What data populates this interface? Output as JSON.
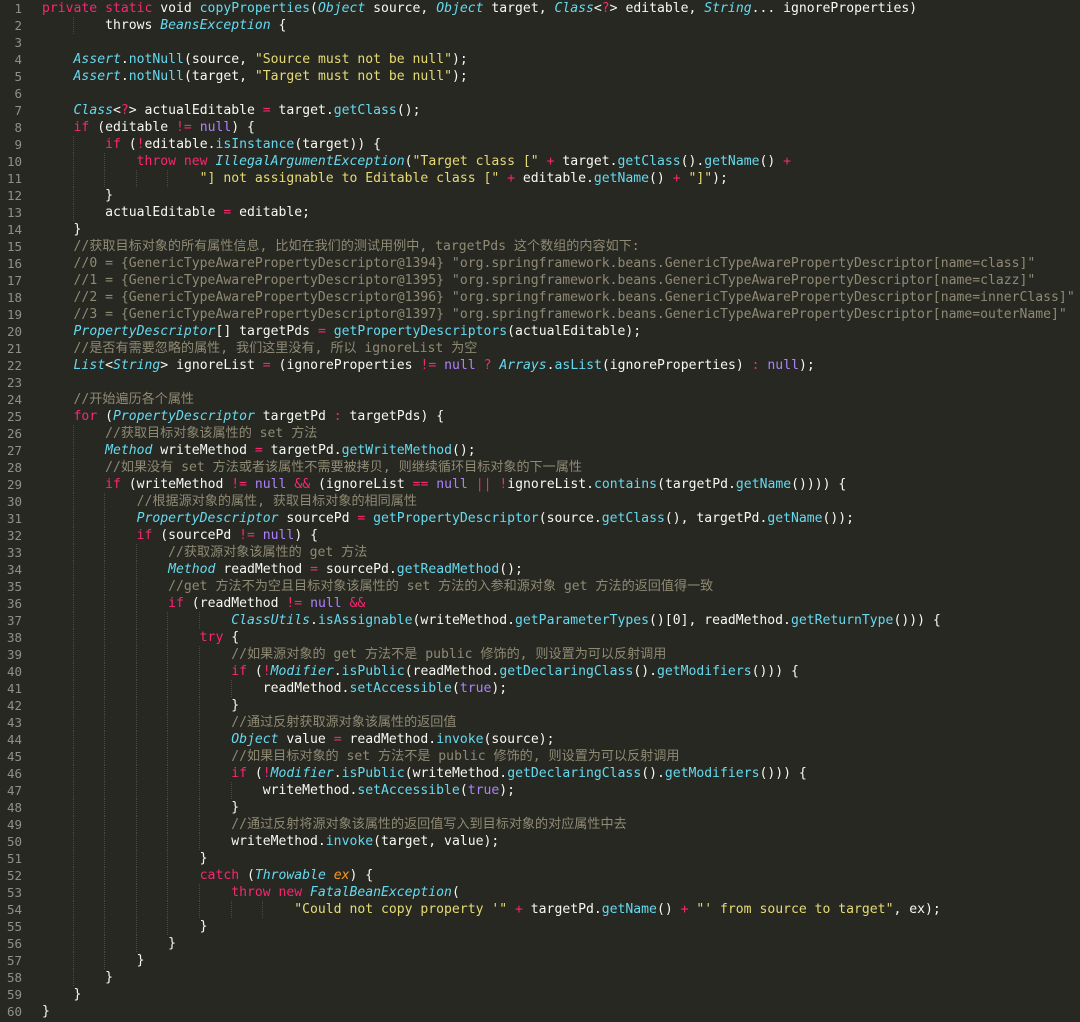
{
  "editor": {
    "theme_colors": {
      "background": "#272822",
      "text": "#f8f8f2",
      "keyword": "#f92672",
      "string": "#e6db74",
      "function": "#66d9ef",
      "comment": "#8f8a74",
      "parameter": "#fd971f",
      "constant": "#ae81ff",
      "line_number": "#90908a"
    },
    "lines": [
      [
        [
          "k",
          "private static "
        ],
        [
          "g",
          "void "
        ],
        [
          "f",
          "copyProperties"
        ],
        [
          "g",
          "("
        ],
        [
          "t",
          "Object"
        ],
        [
          "g",
          " source, "
        ],
        [
          "t",
          "Object"
        ],
        [
          "g",
          " target, "
        ],
        [
          "t",
          "Class"
        ],
        [
          "g",
          "<"
        ],
        [
          "k",
          "?"
        ],
        [
          "g",
          "> editable, "
        ],
        [
          "t",
          "String"
        ],
        [
          "g",
          "... ignoreProperties)"
        ]
      ],
      [
        [
          "g",
          "        throws "
        ],
        [
          "t",
          "BeansException"
        ],
        [
          "g",
          " {"
        ]
      ],
      [
        [
          "g",
          ""
        ]
      ],
      [
        [
          "g",
          "    "
        ],
        [
          "t",
          "Assert"
        ],
        [
          "g",
          "."
        ],
        [
          "f",
          "notNull"
        ],
        [
          "g",
          "(source, "
        ],
        [
          "s",
          "\"Source must not be null\""
        ],
        [
          "g",
          ");"
        ]
      ],
      [
        [
          "g",
          "    "
        ],
        [
          "t",
          "Assert"
        ],
        [
          "g",
          "."
        ],
        [
          "f",
          "notNull"
        ],
        [
          "g",
          "(target, "
        ],
        [
          "s",
          "\"Target must not be null\""
        ],
        [
          "g",
          ");"
        ]
      ],
      [
        [
          "g",
          ""
        ]
      ],
      [
        [
          "g",
          "    "
        ],
        [
          "t",
          "Class"
        ],
        [
          "g",
          "<"
        ],
        [
          "k",
          "?"
        ],
        [
          "g",
          "> actualEditable "
        ],
        [
          "k",
          "="
        ],
        [
          "g",
          " target."
        ],
        [
          "f",
          "getClass"
        ],
        [
          "g",
          "();"
        ]
      ],
      [
        [
          "g",
          "    "
        ],
        [
          "k",
          "if"
        ],
        [
          "g",
          " (editable "
        ],
        [
          "k",
          "!="
        ],
        [
          "g",
          " "
        ],
        [
          "n",
          "null"
        ],
        [
          "g",
          ") {"
        ]
      ],
      [
        [
          "g",
          "        "
        ],
        [
          "k",
          "if"
        ],
        [
          "g",
          " ("
        ],
        [
          "k",
          "!"
        ],
        [
          "g",
          "editable."
        ],
        [
          "f",
          "isInstance"
        ],
        [
          "g",
          "(target)) {"
        ]
      ],
      [
        [
          "g",
          "            "
        ],
        [
          "k",
          "throw new "
        ],
        [
          "t",
          "IllegalArgumentException"
        ],
        [
          "g",
          "("
        ],
        [
          "s",
          "\"Target class [\""
        ],
        [
          "g",
          " "
        ],
        [
          "k",
          "+"
        ],
        [
          "g",
          " target."
        ],
        [
          "f",
          "getClass"
        ],
        [
          "g",
          "()."
        ],
        [
          "f",
          "getName"
        ],
        [
          "g",
          "() "
        ],
        [
          "k",
          "+"
        ]
      ],
      [
        [
          "g",
          "                    "
        ],
        [
          "s",
          "\"] not assignable to Editable class [\""
        ],
        [
          "g",
          " "
        ],
        [
          "k",
          "+"
        ],
        [
          "g",
          " editable."
        ],
        [
          "f",
          "getName"
        ],
        [
          "g",
          "() "
        ],
        [
          "k",
          "+"
        ],
        [
          "g",
          " "
        ],
        [
          "s",
          "\"]\""
        ],
        [
          "g",
          ");"
        ]
      ],
      [
        [
          "g",
          "        }"
        ]
      ],
      [
        [
          "g",
          "        actualEditable "
        ],
        [
          "k",
          "="
        ],
        [
          "g",
          " editable;"
        ]
      ],
      [
        [
          "g",
          "    }"
        ]
      ],
      [
        [
          "g",
          "    "
        ],
        [
          "c",
          "//获取目标对象的所有属性信息, 比如在我们的测试用例中, targetPds 这个数组的内容如下:"
        ]
      ],
      [
        [
          "g",
          "    "
        ],
        [
          "c",
          "//0 = {GenericTypeAwarePropertyDescriptor@1394} \"org.springframework.beans.GenericTypeAwarePropertyDescriptor[name=class]\""
        ]
      ],
      [
        [
          "g",
          "    "
        ],
        [
          "c",
          "//1 = {GenericTypeAwarePropertyDescriptor@1395} \"org.springframework.beans.GenericTypeAwarePropertyDescriptor[name=clazz]\""
        ]
      ],
      [
        [
          "g",
          "    "
        ],
        [
          "c",
          "//2 = {GenericTypeAwarePropertyDescriptor@1396} \"org.springframework.beans.GenericTypeAwarePropertyDescriptor[name=innerClass]\""
        ]
      ],
      [
        [
          "g",
          "    "
        ],
        [
          "c",
          "//3 = {GenericTypeAwarePropertyDescriptor@1397} \"org.springframework.beans.GenericTypeAwarePropertyDescriptor[name=outerName]\""
        ]
      ],
      [
        [
          "g",
          "    "
        ],
        [
          "t",
          "PropertyDescriptor"
        ],
        [
          "g",
          "[] targetPds "
        ],
        [
          "k",
          "="
        ],
        [
          "g",
          " "
        ],
        [
          "f",
          "getPropertyDescriptors"
        ],
        [
          "g",
          "(actualEditable);"
        ]
      ],
      [
        [
          "g",
          "    "
        ],
        [
          "c",
          "//是否有需要忽略的属性, 我们这里没有, 所以 ignoreList 为空"
        ]
      ],
      [
        [
          "g",
          "    "
        ],
        [
          "t",
          "List"
        ],
        [
          "g",
          "<"
        ],
        [
          "t",
          "String"
        ],
        [
          "g",
          "> ignoreList "
        ],
        [
          "k",
          "="
        ],
        [
          "g",
          " (ignoreProperties "
        ],
        [
          "k",
          "!="
        ],
        [
          "g",
          " "
        ],
        [
          "n",
          "null"
        ],
        [
          "g",
          " "
        ],
        [
          "k",
          "?"
        ],
        [
          "g",
          " "
        ],
        [
          "t",
          "Arrays"
        ],
        [
          "g",
          "."
        ],
        [
          "f",
          "asList"
        ],
        [
          "g",
          "(ignoreProperties) "
        ],
        [
          "k",
          ":"
        ],
        [
          "g",
          " "
        ],
        [
          "n",
          "null"
        ],
        [
          "g",
          ");"
        ]
      ],
      [
        [
          "g",
          ""
        ]
      ],
      [
        [
          "g",
          "    "
        ],
        [
          "c",
          "//开始遍历各个属性"
        ]
      ],
      [
        [
          "g",
          "    "
        ],
        [
          "k",
          "for"
        ],
        [
          "g",
          " ("
        ],
        [
          "t",
          "PropertyDescriptor"
        ],
        [
          "g",
          " targetPd "
        ],
        [
          "k",
          ":"
        ],
        [
          "g",
          " targetPds) {"
        ]
      ],
      [
        [
          "g",
          "        "
        ],
        [
          "c",
          "//获取目标对象该属性的 set 方法"
        ]
      ],
      [
        [
          "g",
          "        "
        ],
        [
          "t",
          "Method"
        ],
        [
          "g",
          " writeMethod "
        ],
        [
          "k",
          "="
        ],
        [
          "g",
          " targetPd."
        ],
        [
          "f",
          "getWriteMethod"
        ],
        [
          "g",
          "();"
        ]
      ],
      [
        [
          "g",
          "        "
        ],
        [
          "c",
          "//如果没有 set 方法或者该属性不需要被拷贝, 则继续循环目标对象的下一属性"
        ]
      ],
      [
        [
          "g",
          "        "
        ],
        [
          "k",
          "if"
        ],
        [
          "g",
          " (writeMethod "
        ],
        [
          "k",
          "!="
        ],
        [
          "g",
          " "
        ],
        [
          "n",
          "null"
        ],
        [
          "g",
          " "
        ],
        [
          "k",
          "&&"
        ],
        [
          "g",
          " (ignoreList "
        ],
        [
          "k",
          "=="
        ],
        [
          "g",
          " "
        ],
        [
          "n",
          "null"
        ],
        [
          "g",
          " "
        ],
        [
          "k",
          "||"
        ],
        [
          "g",
          " "
        ],
        [
          "k",
          "!"
        ],
        [
          "g",
          "ignoreList."
        ],
        [
          "f",
          "contains"
        ],
        [
          "g",
          "(targetPd."
        ],
        [
          "f",
          "getName"
        ],
        [
          "g",
          "()))) {"
        ]
      ],
      [
        [
          "g",
          "            "
        ],
        [
          "c",
          "//根据源对象的属性, 获取目标对象的相同属性"
        ]
      ],
      [
        [
          "g",
          "            "
        ],
        [
          "t",
          "PropertyDescriptor"
        ],
        [
          "g",
          " sourcePd "
        ],
        [
          "k",
          "="
        ],
        [
          "g",
          " "
        ],
        [
          "f",
          "getPropertyDescriptor"
        ],
        [
          "g",
          "(source."
        ],
        [
          "f",
          "getClass"
        ],
        [
          "g",
          "(), targetPd."
        ],
        [
          "f",
          "getName"
        ],
        [
          "g",
          "());"
        ]
      ],
      [
        [
          "g",
          "            "
        ],
        [
          "k",
          "if"
        ],
        [
          "g",
          " (sourcePd "
        ],
        [
          "k",
          "!="
        ],
        [
          "g",
          " "
        ],
        [
          "n",
          "null"
        ],
        [
          "g",
          ") {"
        ]
      ],
      [
        [
          "g",
          "                "
        ],
        [
          "c",
          "//获取源对象该属性的 get 方法"
        ]
      ],
      [
        [
          "g",
          "                "
        ],
        [
          "t",
          "Method"
        ],
        [
          "g",
          " readMethod "
        ],
        [
          "k",
          "="
        ],
        [
          "g",
          " sourcePd."
        ],
        [
          "f",
          "getReadMethod"
        ],
        [
          "g",
          "();"
        ]
      ],
      [
        [
          "g",
          "                "
        ],
        [
          "c",
          "//get 方法不为空且目标对象该属性的 set 方法的入参和源对象 get 方法的返回值得一致"
        ]
      ],
      [
        [
          "g",
          "                "
        ],
        [
          "k",
          "if"
        ],
        [
          "g",
          " (readMethod "
        ],
        [
          "k",
          "!="
        ],
        [
          "g",
          " "
        ],
        [
          "n",
          "null"
        ],
        [
          "g",
          " "
        ],
        [
          "k",
          "&&"
        ]
      ],
      [
        [
          "g",
          "                        "
        ],
        [
          "t",
          "ClassUtils"
        ],
        [
          "g",
          "."
        ],
        [
          "f",
          "isAssignable"
        ],
        [
          "g",
          "(writeMethod."
        ],
        [
          "f",
          "getParameterTypes"
        ],
        [
          "g",
          "()[0], readMethod."
        ],
        [
          "f",
          "getReturnType"
        ],
        [
          "g",
          "())) {"
        ]
      ],
      [
        [
          "g",
          "                    "
        ],
        [
          "k",
          "try"
        ],
        [
          "g",
          " {"
        ]
      ],
      [
        [
          "g",
          "                        "
        ],
        [
          "c",
          "//如果源对象的 get 方法不是 public 修饰的, 则设置为可以反射调用"
        ]
      ],
      [
        [
          "g",
          "                        "
        ],
        [
          "k",
          "if"
        ],
        [
          "g",
          " ("
        ],
        [
          "k",
          "!"
        ],
        [
          "t",
          "Modifier"
        ],
        [
          "g",
          "."
        ],
        [
          "f",
          "isPublic"
        ],
        [
          "g",
          "(readMethod."
        ],
        [
          "f",
          "getDeclaringClass"
        ],
        [
          "g",
          "()."
        ],
        [
          "f",
          "getModifiers"
        ],
        [
          "g",
          "())) {"
        ]
      ],
      [
        [
          "g",
          "                            readMethod."
        ],
        [
          "f",
          "setAccessible"
        ],
        [
          "g",
          "("
        ],
        [
          "n",
          "true"
        ],
        [
          "g",
          ");"
        ]
      ],
      [
        [
          "g",
          "                        }"
        ]
      ],
      [
        [
          "g",
          "                        "
        ],
        [
          "c",
          "//通过反射获取源对象该属性的返回值"
        ]
      ],
      [
        [
          "g",
          "                        "
        ],
        [
          "t",
          "Object"
        ],
        [
          "g",
          " value "
        ],
        [
          "k",
          "="
        ],
        [
          "g",
          " readMethod."
        ],
        [
          "f",
          "invoke"
        ],
        [
          "g",
          "(source);"
        ]
      ],
      [
        [
          "g",
          "                        "
        ],
        [
          "c",
          "//如果目标对象的 set 方法不是 public 修饰的, 则设置为可以反射调用"
        ]
      ],
      [
        [
          "g",
          "                        "
        ],
        [
          "k",
          "if"
        ],
        [
          "g",
          " ("
        ],
        [
          "k",
          "!"
        ],
        [
          "t",
          "Modifier"
        ],
        [
          "g",
          "."
        ],
        [
          "f",
          "isPublic"
        ],
        [
          "g",
          "(writeMethod."
        ],
        [
          "f",
          "getDeclaringClass"
        ],
        [
          "g",
          "()."
        ],
        [
          "f",
          "getModifiers"
        ],
        [
          "g",
          "())) {"
        ]
      ],
      [
        [
          "g",
          "                            writeMethod."
        ],
        [
          "f",
          "setAccessible"
        ],
        [
          "g",
          "("
        ],
        [
          "n",
          "true"
        ],
        [
          "g",
          ");"
        ]
      ],
      [
        [
          "g",
          "                        }"
        ]
      ],
      [
        [
          "g",
          "                        "
        ],
        [
          "c",
          "//通过反射将源对象该属性的返回值写入到目标对象的对应属性中去"
        ]
      ],
      [
        [
          "g",
          "                        writeMethod."
        ],
        [
          "f",
          "invoke"
        ],
        [
          "g",
          "(target, value);"
        ]
      ],
      [
        [
          "g",
          "                    }"
        ]
      ],
      [
        [
          "g",
          "                    "
        ],
        [
          "k",
          "catch"
        ],
        [
          "g",
          " ("
        ],
        [
          "t",
          "Throwable"
        ],
        [
          "g",
          " "
        ],
        [
          "p",
          "ex"
        ],
        [
          "g",
          ") {"
        ]
      ],
      [
        [
          "g",
          "                        "
        ],
        [
          "k",
          "throw new "
        ],
        [
          "t",
          "FatalBeanException"
        ],
        [
          "g",
          "("
        ]
      ],
      [
        [
          "g",
          "                                "
        ],
        [
          "s",
          "\"Could not copy property '\""
        ],
        [
          "g",
          " "
        ],
        [
          "k",
          "+"
        ],
        [
          "g",
          " targetPd."
        ],
        [
          "f",
          "getName"
        ],
        [
          "g",
          "() "
        ],
        [
          "k",
          "+"
        ],
        [
          "g",
          " "
        ],
        [
          "s",
          "\"' from source to target\""
        ],
        [
          "g",
          ", ex);"
        ]
      ],
      [
        [
          "g",
          "                    }"
        ]
      ],
      [
        [
          "g",
          "                }"
        ]
      ],
      [
        [
          "g",
          "            }"
        ]
      ],
      [
        [
          "g",
          "        }"
        ]
      ],
      [
        [
          "g",
          "    }"
        ]
      ],
      [
        [
          "g",
          "}"
        ]
      ],
      [
        [
          "g",
          ""
        ]
      ]
    ]
  }
}
